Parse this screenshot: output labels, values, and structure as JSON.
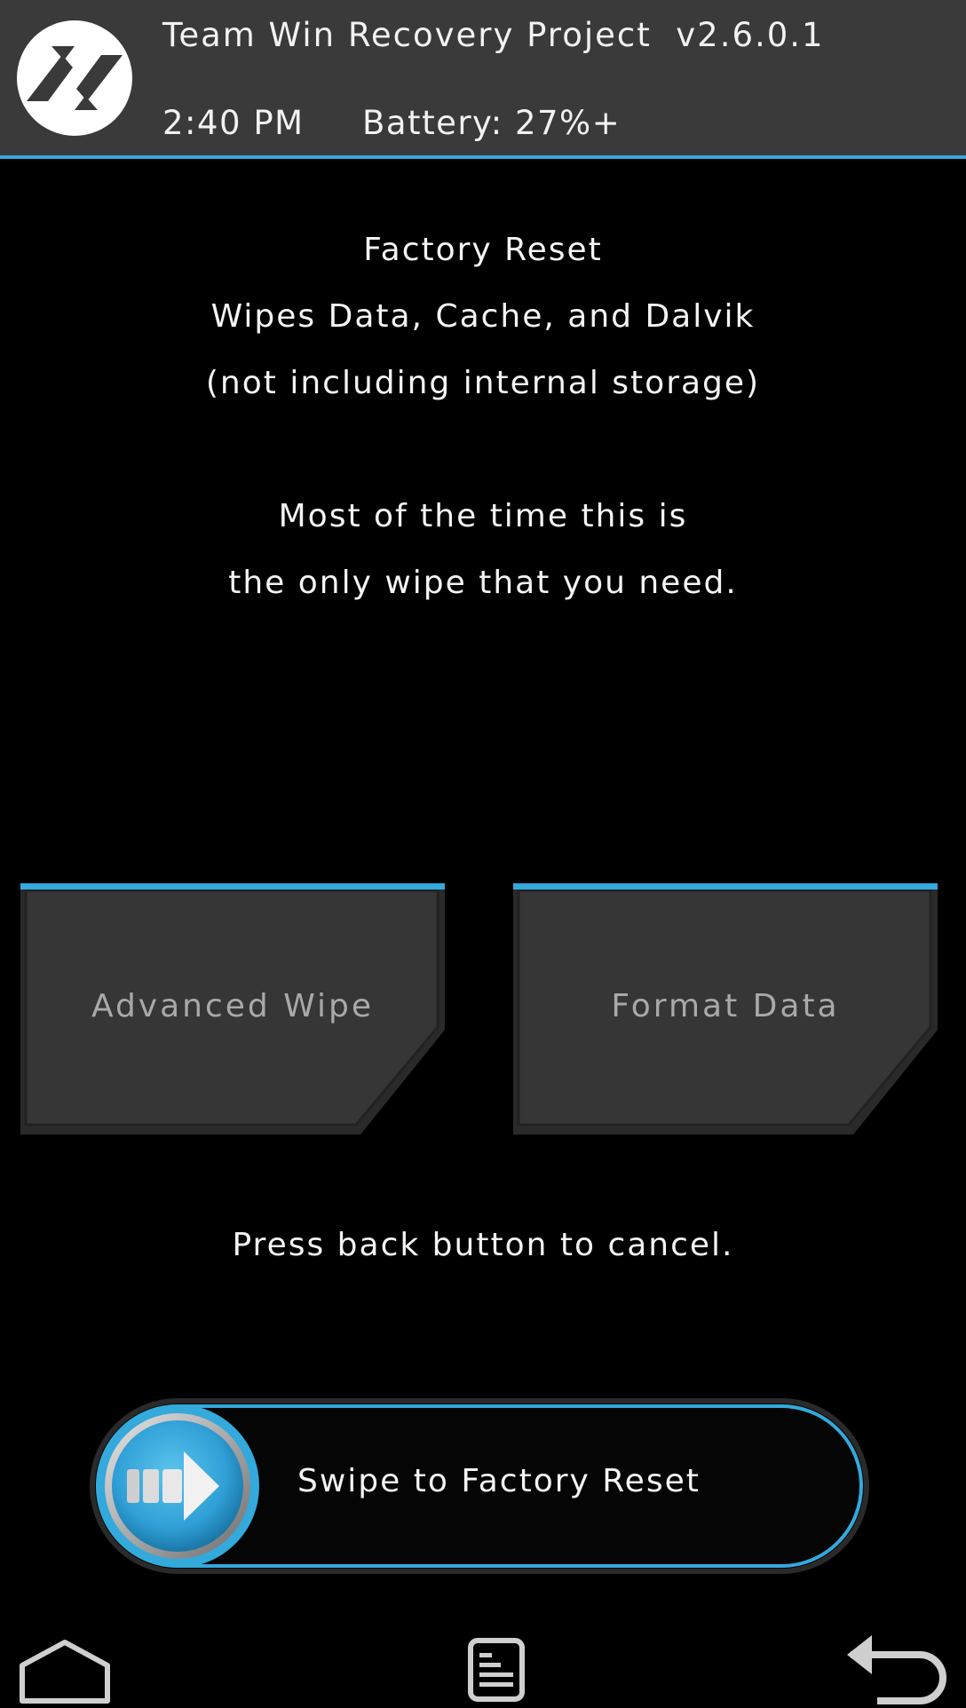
{
  "header": {
    "app_title": "Team Win Recovery Project  v2.6.0.1",
    "time": "2:40 PM",
    "battery": "Battery: 27%+",
    "logo_icon": "twrp-logo-icon"
  },
  "description": {
    "lines": [
      "Factory Reset",
      "Wipes Data, Cache, and Dalvik",
      "(not including internal storage)",
      "Most of the time this is",
      "the only wipe that you need."
    ]
  },
  "buttons": {
    "advanced_wipe": "Advanced Wipe",
    "format_data": "Format Data"
  },
  "cancel_hint": "Press back button to cancel.",
  "slider": {
    "label": "Swipe to Factory Reset",
    "handle_icon": "arrow-right-icon"
  },
  "navbar": {
    "home_icon": "home-icon",
    "console_icon": "console-icon",
    "back_icon": "back-arrow-icon"
  },
  "colors": {
    "accent": "#33a9dc",
    "header_bg": "#3a3a3a",
    "button_bg": "#353535",
    "background": "#000000",
    "button_text": "#a9a9a9"
  }
}
